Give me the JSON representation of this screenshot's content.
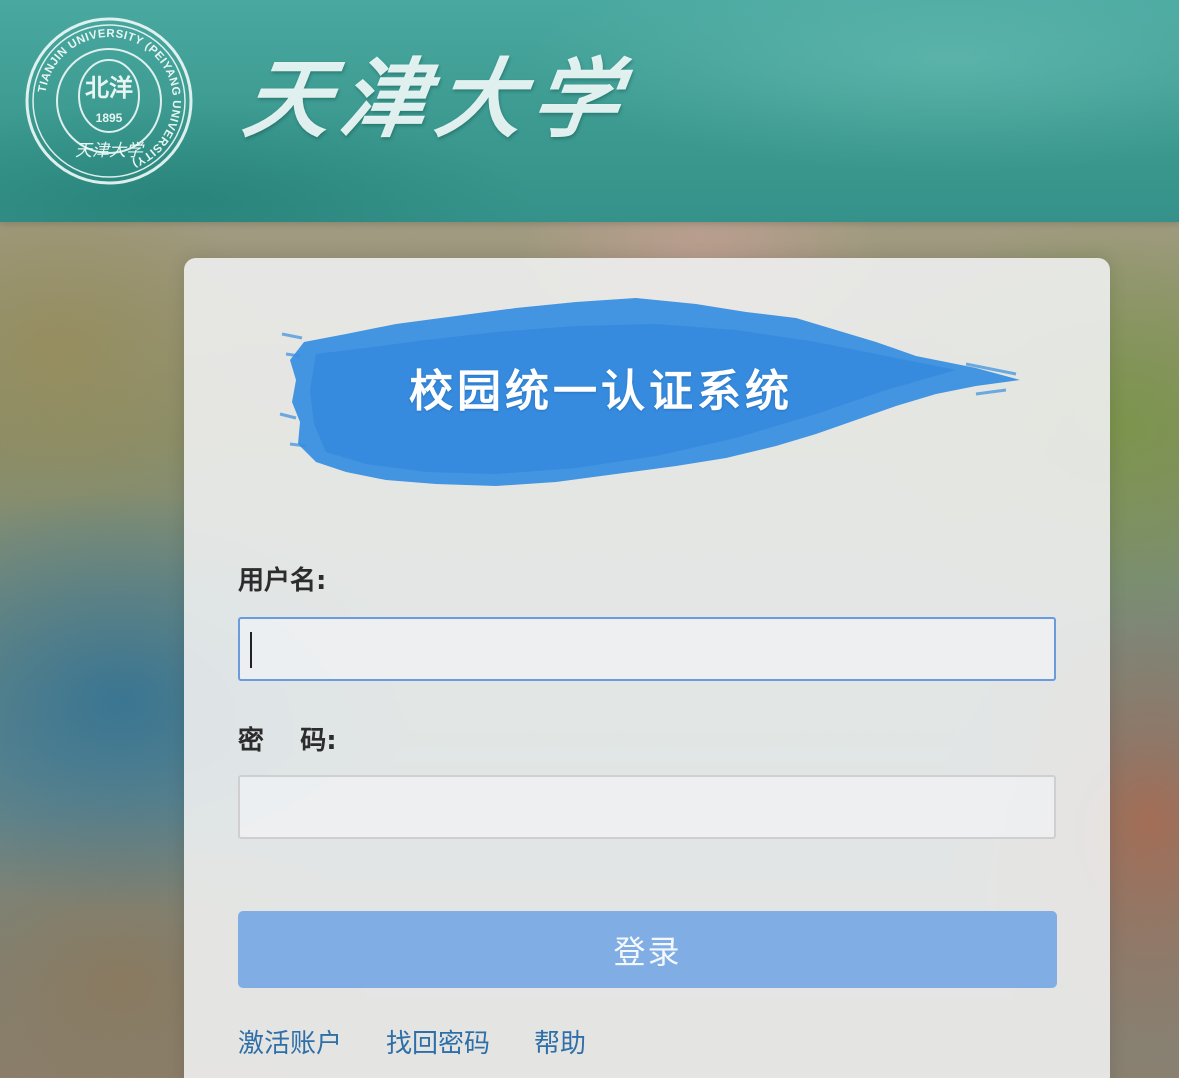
{
  "header": {
    "seal_icon": "tianjin-university-seal",
    "seal_text": "TIANJIN UNIVERSITY (PEIYANG UNIVERSITY)",
    "seal_center": "北洋",
    "seal_year": "1895",
    "seal_bottom": "天津大学",
    "brand_name": "天津大学",
    "color": "#3c9a90"
  },
  "login": {
    "banner_title": "校园统一认证系统",
    "banner_color": "#3a8fe0",
    "username_label": "用户名:",
    "username_value": "",
    "password_label": "密    码:",
    "password_value": "",
    "submit_label": "登录",
    "button_color": "#6ea4e4",
    "links": {
      "activate": "激活账户",
      "recover": "找回密码",
      "help": "帮助"
    }
  }
}
